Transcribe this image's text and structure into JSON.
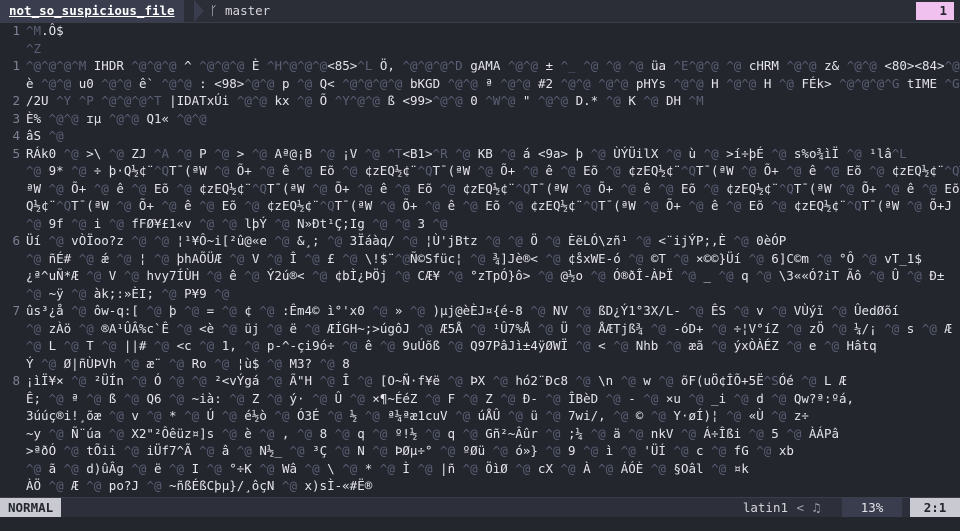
{
  "topbar": {
    "file_name": "not_so_suspicious_file",
    "branch_icon": "git-branch-icon",
    "branch": "master",
    "buffer_count": "1"
  },
  "editor": {
    "lines": [
      {
        "num": "1",
        "current": false,
        "text": "^M.Ô$"
      },
      {
        "num": "",
        "current": true,
        "text": "^Z"
      },
      {
        "num": "1",
        "current": false,
        "text": "^@^@^@^M IHDR ^@^@^@ ^ ^@^@^@ È ^H^@^@^@<85>^L Ö, ^@^@^@^D gAMA ^@^@ ± ^_ ^@ ^@ ^@ üa ^E^@^@ ^@ cHRM ^@^@ z& ^@^@ <80><84>^@^@ ú"
      },
      {
        "num": "",
        "current": false,
        "text": "è ^@^@ u0 ^@^@ ê` ^@^@ : <98>^@^@ p ^@ Q< ^@^@^@^@ bKGD ^@^@ ª ^@^@ #2 ^@^@ ^@^@ pHYs ^@^@ H ^@^@ H ^@ FÉk> ^@^@^@^G tIME ^G é"
      },
      {
        "num": "2",
        "current": false,
        "text": "/2U ^Y ^P ^@^@^@^T |IDATxÚi ^@^@ kx ^@ Õ ^Y^@^@ ß <99>^@^@ 0 ^W^@ \" ^@^@ D.* ^@ K ^@ DH ^M"
      },
      {
        "num": "3",
        "current": false,
        "text": "È% ^@^@ ɪµ ^@^@ Q1« ^@^@"
      },
      {
        "num": "4",
        "current": false,
        "text": "âS ^@"
      },
      {
        "num": "5",
        "current": false,
        "text": "RÁk0 ^@ >\\ ^@ ZJ ^A ^@ P ^@ > ^@ Aª@¡B ^@ ¡V ^@ ^T<B1>^R ^@ KB ^@ á <9a> þ ^@ ÙÝÜilX ^@ ù ^@ >í÷þÉ ^@ s%o¾ìÏ ^@ ¹lâ^L"
      },
      {
        "num": "",
        "current": false,
        "text": "^@ 9* ^@ ÷ þ·Q½¢¨^QT¯(ªW ^@ Õ+ ^@ ê ^@ Eõ ^@ ¢zEQ½¢¨^QT¯(ªW ^@ Õ+ ^@ ê ^@ Eõ ^@ ¢zEQ½¢¨^QT¯(ªW ^@ Õ+ ^@ ê ^@ Eõ ^@ ¢zEQ½¢¨^QT¯("
      },
      {
        "num": "",
        "current": false,
        "text": "ªW ^@ Õ+ ^@ ê ^@ Eõ ^@ ¢zEQ½¢¨^QT¯(ªW ^@ Õ+ ^@ ê ^@ Eõ ^@ ¢zEQ½¢¨^QT¯(ªW ^@ Õ+ ^@ ê ^@ Eõ ^@ ¢zEQ½¢¨^QT¯(ªW ^@ Õ+ ^@ ê ^@ Eõ ^@ ¢zE"
      },
      {
        "num": "",
        "current": false,
        "text": "Q½¢¨^QT¯(ªW ^@ Õ+ ^@ ê ^@ Eõ ^@ ¢zEQ½¢¨^QT¯(ªW ^@ Õ+ ^@ ê ^@ Eõ ^@ ¢zEQ½¢¨^QT¯(ªW ^@ Õ+ ^@ ê ^@ Eõ ^@ ¢zEQ½¢¨^QT¯(ªW ^@ Õ+J ^@ ^@ ^@"
      },
      {
        "num": "",
        "current": false,
        "text": "^@ 9f ^@ i ^@ fFØ¥£1«v ^@ ^@ lþÝ ^@ N»Ðt¹Ç;Ig ^@ ^@ 3 ^@"
      },
      {
        "num": "6",
        "current": false,
        "text": "Üí ^@ vÒÏoo?z ^@ ^@ ¦¹¥Ô~i[²û@«e ^@ &¸; ^@ 3Ïáàq/ ^@ ¦Ù'jBtz ^@ ^@ Ö ^@ ÈëLÓ\\zñ¹ ^@ <¨ijÝP;,È ^@ 0èÓP"
      },
      {
        "num": "",
        "current": false,
        "text": "^@ ñÉ# ^@ ǽ ^@ ¦ ^@ þhAÕÜÆ ^@ V ^@ Î ^@ £ ^@ \\!$¨^@Ñ©Sfüc¦ ^@ ¾]Jè®< ^@ ¢s̊xWE-ó ^@ ©T ^@ ×©©}Üí ^@ 6]C©m ^@ °Ô ^@ vT_1$"
      },
      {
        "num": "",
        "current": false,
        "text": "¿ª^uÑ*Æ ^@ V ^@ hvy7ÍÙH ^@ ê ^@ Ý2ú®< ^@ ¢bÌ¿ÞÖj ^@ CÆ¥ ^@ °zTpÓ}ô> ^@ @½o ^@ Ó®ðÎ-ÀÞÏ ^@ _ ^@ q ^@ \\3««Ó?iT Ãô ^@ Û ^@ Ð±"
      },
      {
        "num": "",
        "current": false,
        "text": "^@ ~ÿ ^@ àk;:»ÈI; ^@ P¥9 ^@"
      },
      {
        "num": "7",
        "current": false,
        "text": "ûs³¿å ^@ ôw-q:[ ^@ þ ^@ = ^@ ¢ ^@ :Êm4© ì°'x0 ^@ » ^@ )µj@èÈJ¤{é-8 ^@ NV ^@ ßD¿Ý1°3X/L- ^@ ÊS ^@ v ^@ VÙýï ^@ ÛedØõí"
      },
      {
        "num": "",
        "current": false,
        "text": "^@ zÀö ^@ ®A¹ÛÂ%c`Ê ^@ <è ^@ üj ^@ ë ^@ ÆÍGH~;>úgôJ ^@ Æ5Å ^@ ¹Û7%Å ^@ Ü ^@ ÅÆTjß¾ ^@ -óD+ ^@ ÷¦V°íZ ^@ zÖ ^@ ¼/¡ ^@ s ^@ Æ"
      },
      {
        "num": "",
        "current": false,
        "text": "^@ L ^@ T ^@ ||# ^@ <c ^@ 1, ^@ p-^-çi9ó÷ ^@ ê ^@ 9uÚõß ^@ Q97PâJì±4ÿØWÏ ^@ < ^@ Nhb ^@ æã ^@ ýxÒÀÉZ ^@ e ^@ Hâtq"
      },
      {
        "num": "",
        "current": false,
        "text": "Ý ^@ Ø|ñÙÞVh ^@ æ¨ ^@ Ro ^@ ¦ù$ ^@ M3? ^@ 8"
      },
      {
        "num": "8",
        "current": false,
        "text": "¡ìÏ¥× ^@ ²ÜÍn ^@ Ó ^@ ^@ ²<vÝgá ^@ Ã\"H ^@ Î ^@ [O~Ñ·f¥ë ^@ ÞX ^@ hó2¨Ðc8 ^@ \\n ^@ w ^@ õF(uÖ¢ÎÕ+5Ë^SÓé ^@ L Æ"
      },
      {
        "num": "",
        "current": false,
        "text": "Ê; ^@ ª ^@ ß ^@ Q6 ^@ ~ià: ^@ Z ^@ ý· ^@ Û ^@ ×¶~ÉéZ ^@ F ^@ Z ^@ Ð- ^@ ÎBèD ^@ - ^@ ×u ^@ _i ^@ d ^@ Qw?ª:ºá,"
      },
      {
        "num": "",
        "current": false,
        "text": "3úúç®i!¸õæ ^@ v ^@ * ^@ Ú ^@ é½ò ^@ Ó3É ^@ ½ ^@ ª¼ªæ1cuV ^@ úÅÛ ^@ ü ^@ 7wi/, ^@ © ^@ Y·øÍ)¦ ^@ «Ù ^@ z÷"
      },
      {
        "num": "",
        "current": false,
        "text": "~y ^@ Ñ¨úa ^@ X2\"²Ôêüz¤]s ^@ è ^@ , ^@ 8 ^@ q ^@ º!½ ^@ q ^@ Gñ²~Âûr ^@ ;¼ ^@ ä ^@ nkV ^@ Á÷Îßi ^@ 5 ^@ ÀÁPâ"
      },
      {
        "num": "",
        "current": false,
        "text": ">ªðÓ ^@ tÕii ^@ iÜf7^Ã ^@ â ^@ N½_ ^@ ³Ç ^@ N ^@ ÞØµ÷° ^@ ºØü ^@ ó»} ^@ 9 ^@ ì ^@ 'ÜÍ ^@ c ^@ fG ^@ xb"
      },
      {
        "num": "",
        "current": false,
        "text": "^@ ã ^@ d)ûÂg ^@ ë ^@ I ^@ °÷K ^@ Wâ ^@ \\ ^@ * ^@ Ì ^@ |ñ ^@ ÖìØ ^@ cX ^@ À ^@ ÁÓÈ ^@ §Oâl ^@ ¤k"
      },
      {
        "num": "",
        "current": false,
        "text": "ÀÖ ^@ Æ ^@ po?J ^@ ~ñßÉßCþµ}/¸ôçN ^@ x)sÌ-«#Ë®"
      },
      {
        "num": "9",
        "current": false,
        "text": "^@ K ^@ J°ÿ± ^@ :/ ^@ &¤D ^@ ê ^@ ðM¿³^¥æ ^@ } ^@ U`¡ ^@ öAÔ-h5°Ñµ.-É ^@ °] ^@ 9Æ°RTñù¨ë¡ØÓ¿$0³*NO÷ê-"
      }
    ]
  },
  "statusbar": {
    "mode": "NORMAL",
    "encoding": "latin1",
    "separator_icon": "chevron-left-icon",
    "bell_icon": "bell-icon",
    "percent": "13%",
    "position": "2:1"
  }
}
